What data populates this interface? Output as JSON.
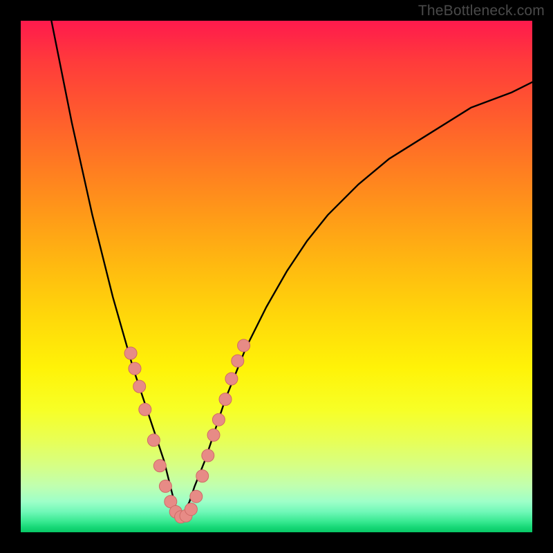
{
  "watermark": "TheBottleneck.com",
  "colors": {
    "frame": "#000000",
    "curve": "#000000",
    "markers_fill": "#e78b86",
    "markers_stroke": "#cf6a66",
    "gradient_stops": [
      "#ff1a4d",
      "#ff3b3b",
      "#ff5a2e",
      "#ff7a22",
      "#ff9a18",
      "#ffba10",
      "#ffd80a",
      "#fff308",
      "#f7ff26",
      "#e8ff55",
      "#d6ff85",
      "#c0ffb0",
      "#9effc8",
      "#70f8b8",
      "#35e88f",
      "#17d877",
      "#08c866"
    ]
  },
  "chart_data": {
    "type": "line",
    "title": "",
    "xlabel": "",
    "ylabel": "",
    "xlim": [
      0,
      100
    ],
    "ylim": [
      0,
      100
    ],
    "description": "V-shaped bottleneck curve with minimum near x≈31; gradient background maps severity from red (high) to green (low).",
    "series": [
      {
        "name": "bottleneck-curve-left",
        "x": [
          6,
          8,
          10,
          12,
          14,
          16,
          18,
          20,
          22,
          24,
          26,
          28,
          29,
          30,
          31
        ],
        "values": [
          100,
          90,
          80,
          71,
          62,
          54,
          46,
          39,
          32,
          26,
          20,
          14,
          10,
          6,
          3
        ]
      },
      {
        "name": "bottleneck-curve-right",
        "x": [
          31,
          32,
          33,
          34,
          36,
          38,
          40,
          44,
          48,
          52,
          56,
          60,
          66,
          72,
          80,
          88,
          96,
          100
        ],
        "values": [
          3,
          4,
          6,
          9,
          14,
          20,
          26,
          36,
          44,
          51,
          57,
          62,
          68,
          73,
          78,
          83,
          86,
          88
        ]
      }
    ],
    "markers": [
      {
        "x": 21.5,
        "y": 35
      },
      {
        "x": 22.3,
        "y": 32
      },
      {
        "x": 23.2,
        "y": 28.5
      },
      {
        "x": 24.3,
        "y": 24
      },
      {
        "x": 26.0,
        "y": 18
      },
      {
        "x": 27.2,
        "y": 13
      },
      {
        "x": 28.3,
        "y": 9
      },
      {
        "x": 29.3,
        "y": 6
      },
      {
        "x": 30.3,
        "y": 4
      },
      {
        "x": 31.3,
        "y": 3
      },
      {
        "x": 32.3,
        "y": 3.2
      },
      {
        "x": 33.3,
        "y": 4.5
      },
      {
        "x": 34.3,
        "y": 7
      },
      {
        "x": 35.5,
        "y": 11
      },
      {
        "x": 36.6,
        "y": 15
      },
      {
        "x": 37.7,
        "y": 19
      },
      {
        "x": 38.7,
        "y": 22
      },
      {
        "x": 40.0,
        "y": 26
      },
      {
        "x": 41.2,
        "y": 30
      },
      {
        "x": 42.4,
        "y": 33.5
      },
      {
        "x": 43.6,
        "y": 36.5
      }
    ]
  }
}
